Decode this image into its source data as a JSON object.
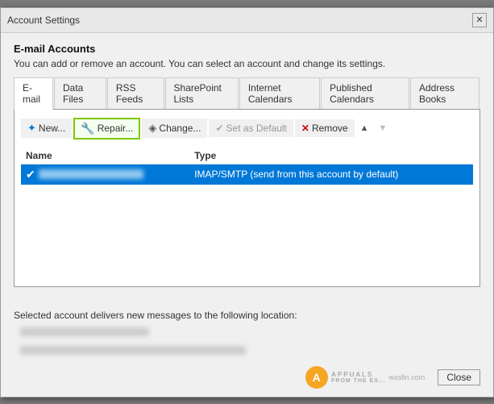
{
  "window": {
    "title": "Account Settings",
    "close_label": "✕"
  },
  "header": {
    "title": "E-mail Accounts",
    "description": "You can add or remove an account. You can select an account and change its settings."
  },
  "tabs": [
    {
      "id": "email",
      "label": "E-mail",
      "active": true
    },
    {
      "id": "data-files",
      "label": "Data Files",
      "active": false
    },
    {
      "id": "rss-feeds",
      "label": "RSS Feeds",
      "active": false
    },
    {
      "id": "sharepoint",
      "label": "SharePoint Lists",
      "active": false
    },
    {
      "id": "internet-cal",
      "label": "Internet Calendars",
      "active": false
    },
    {
      "id": "published-cal",
      "label": "Published Calendars",
      "active": false
    },
    {
      "id": "address-books",
      "label": "Address Books",
      "active": false
    }
  ],
  "toolbar": {
    "new_label": "New...",
    "repair_label": "Repair...",
    "change_label": "Change...",
    "default_label": "Set as Default",
    "remove_label": "Remove",
    "icons": {
      "new": "✦",
      "repair": "🔧",
      "change": "◈",
      "default": "✔",
      "remove": "✕",
      "up": "▲",
      "down": "▼"
    }
  },
  "table": {
    "col_name": "Name",
    "col_type": "Type",
    "rows": [
      {
        "name": "████████████",
        "type": "IMAP/SMTP (send from this account by default)",
        "default": true,
        "selected": true
      }
    ]
  },
  "bottom": {
    "delivers_text": "Selected account delivers new messages to the following location:",
    "location_lines": [
      "████████████████████████",
      "████████████████████████████████████████████"
    ]
  },
  "close_button": "Close",
  "watermark": {
    "site": "wxsfin.com",
    "icon": "A"
  }
}
